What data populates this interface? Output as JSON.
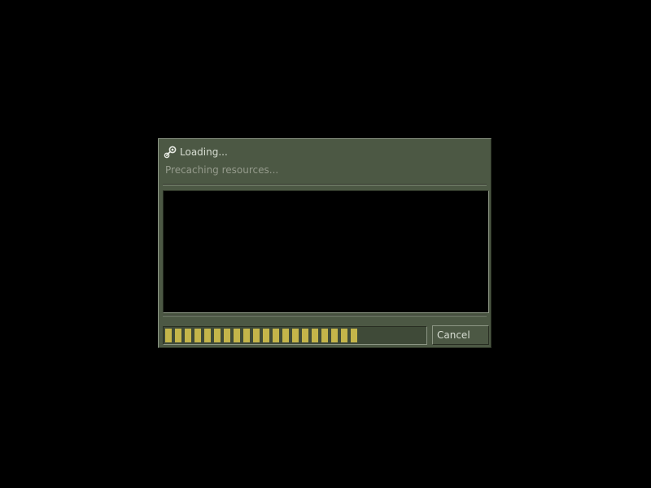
{
  "dialog": {
    "title": "Loading...",
    "subtitle": "Precaching resources...",
    "title_icon": "steam-icon",
    "progress": {
      "filled_blocks": 20,
      "fraction": 0.74
    },
    "cancel_label": "Cancel"
  },
  "colors": {
    "background": "#000000",
    "dialog_bg": "#4c5844",
    "progress_fill": "#c4b54a",
    "title_text": "#d8ded3",
    "subtitle_text": "#959b8c"
  }
}
